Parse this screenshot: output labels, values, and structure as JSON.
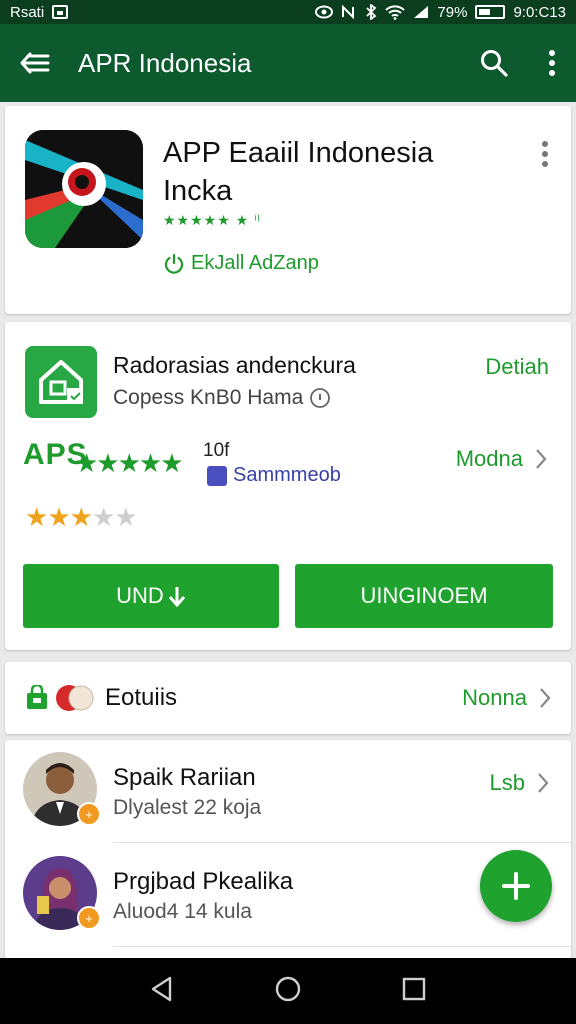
{
  "status_bar": {
    "left_label": "Rsati",
    "battery": "79%",
    "time": "9:0:C13"
  },
  "app_bar": {
    "title": "APR Indonesia",
    "back_icon": "arrow-back-icon",
    "search_icon": "search-icon",
    "menu_icon": "more-vert-icon"
  },
  "app_card": {
    "name": "APP Eaaiil Indonesia Incka",
    "stars_small": "★★★★★ ★ ⁱˡ",
    "developer_link": "EkJall AdZanp"
  },
  "detail_card": {
    "title": "Radorasias andenckura",
    "subtitle": "Copess KnB0 Hama",
    "detail_link": "Detiah",
    "aps_label": "APS",
    "aps_stars": "★★★★★",
    "count": "10f",
    "sam_label": "Sammmeob",
    "modna_label": "Modna",
    "rating": {
      "value": 3,
      "max": 5
    },
    "button_left": "UND",
    "button_right": "UINGINOEM"
  },
  "section_row": {
    "label": "Eotuiis",
    "right_label": "Nonna"
  },
  "people": [
    {
      "name": "Spaik Rariian",
      "sub": "Dlyalest 22 koja",
      "right": "Lsb",
      "badge": "+"
    },
    {
      "name": "Prgjbad Pkealika",
      "sub": "Aluod4 14 kula",
      "right": "",
      "badge": "+"
    }
  ],
  "colors": {
    "accent": "#1fa22e",
    "appbar": "#0e5a2f",
    "statusbar": "#0b3d1f",
    "star": "#f0a21c"
  },
  "nav": {
    "back": "nav-back-icon",
    "home": "nav-home-icon",
    "recents": "nav-recents-icon"
  }
}
